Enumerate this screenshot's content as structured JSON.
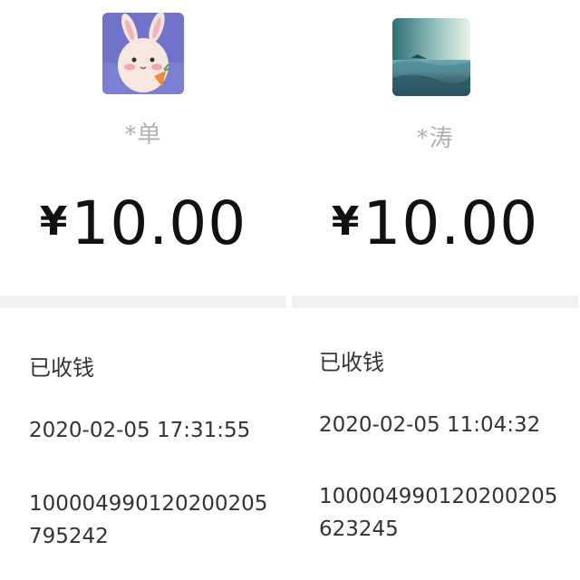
{
  "receipts": [
    {
      "avatar_icon": "bunny-avatar-icon",
      "payer_name": "*单",
      "currency_symbol": "¥",
      "amount": "10.00",
      "status": "已收钱",
      "datetime": "2020-02-05 17:31:55",
      "transaction_id_line1": "100004990120200205",
      "transaction_id_line2": "795242"
    },
    {
      "avatar_icon": "sea-landscape-avatar-icon",
      "payer_name": "*涛",
      "currency_symbol": "¥",
      "amount": "10.00",
      "status": "已收钱",
      "datetime": "2020-02-05 11:04:32",
      "transaction_id_line1": "100004990120200205",
      "transaction_id_line2": "623245"
    }
  ],
  "colors": {
    "amount_text": "#111111",
    "muted_name": "#b0b0b0",
    "divider_band": "#f1f1f1",
    "body_text": "#333333"
  }
}
